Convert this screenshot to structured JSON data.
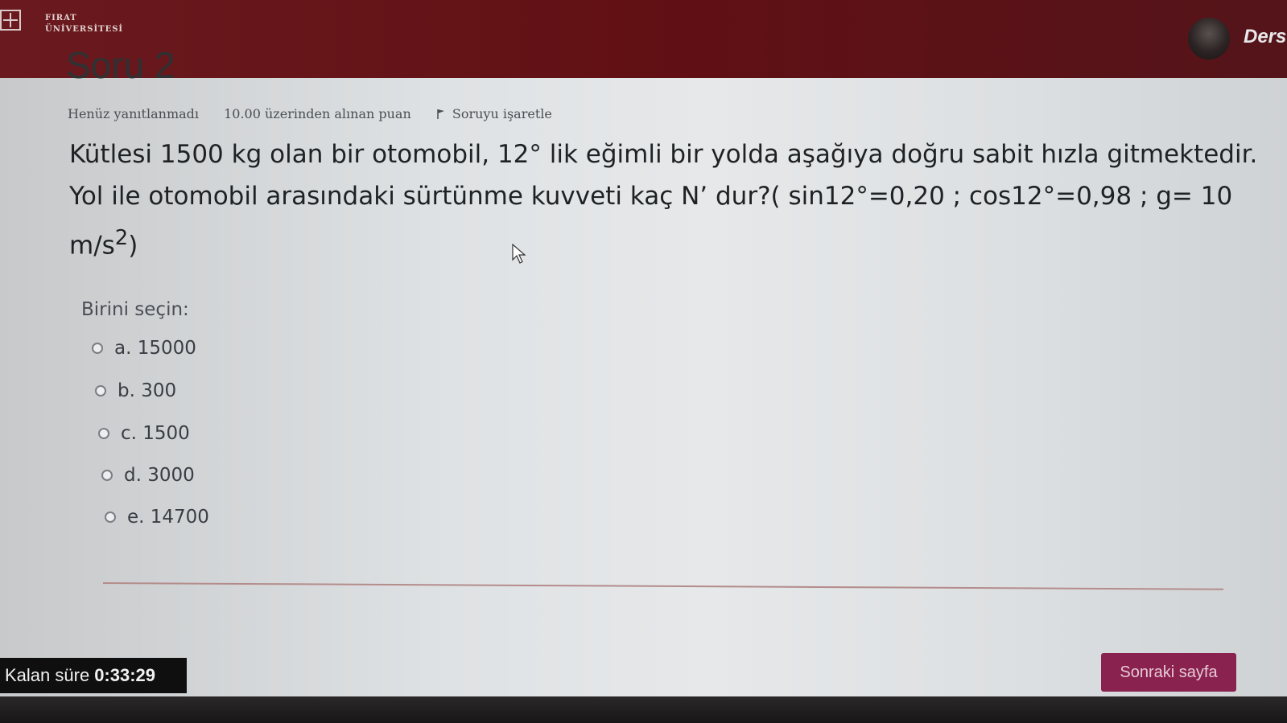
{
  "header": {
    "logo_line1": "FIRAT",
    "logo_line2": "ÜNİVERSİTESİ",
    "user_name": "Ders"
  },
  "question": {
    "title": "Soru 2",
    "status": "Henüz yanıtlanmadı",
    "points": "10.00 üzerinden alınan puan",
    "flag_label": "Soruyu işaretle",
    "text_line1": "Kütlesi 1500 kg olan bir otomobil, 12° lik eğimli bir yolda aşağıya doğru sabit hızla gitmektedir.",
    "text_line2": "Yol ile otomobil arasındaki sürtünme kuvveti kaç N’ dur?( sin12°=0,20 ;  cos12°=0,98  ; g= 10",
    "text_line3_base": "m/s",
    "text_line3_sup": "2",
    "text_line3_end": ")"
  },
  "answers": {
    "prompt": "Birini seçin:",
    "options": [
      {
        "label": "a. 15000"
      },
      {
        "label": "b. 300"
      },
      {
        "label": "c. 1500"
      },
      {
        "label": "d. 3000"
      },
      {
        "label": "e. 14700"
      }
    ]
  },
  "footer": {
    "timer_label": "Kalan süre",
    "timer_value": "0:33:29",
    "next_button": "Sonraki sayfa"
  },
  "colors": {
    "header_bg": "#611014",
    "button_bg": "#8a2250",
    "text": "#1f2224"
  }
}
